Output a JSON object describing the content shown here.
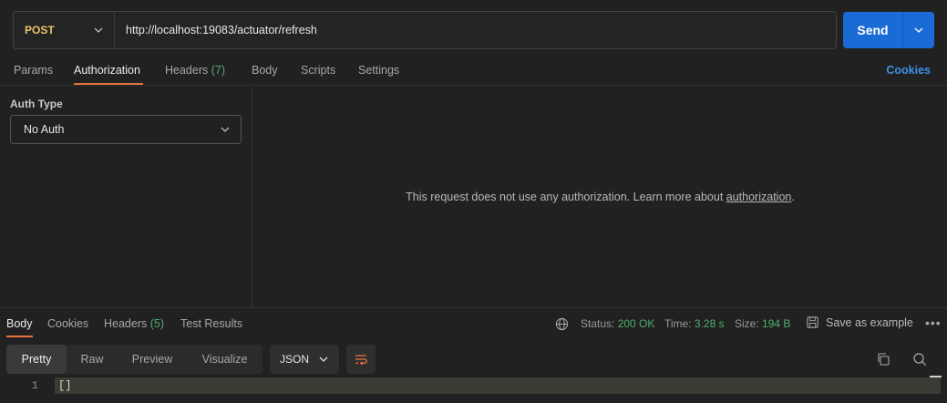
{
  "request": {
    "method": "POST",
    "url": "http://localhost:19083/actuator/refresh",
    "send_label": "Send"
  },
  "request_tabs": {
    "params": "Params",
    "authorization": "Authorization",
    "headers": "Headers",
    "headers_count": "(7)",
    "body": "Body",
    "scripts": "Scripts",
    "settings": "Settings",
    "cookies": "Cookies"
  },
  "auth": {
    "type_label": "Auth Type",
    "selected": "No Auth",
    "message": "This request does not use any authorization. Learn more about ",
    "link": "authorization",
    "message_end": "."
  },
  "response_tabs": {
    "body": "Body",
    "cookies": "Cookies",
    "headers": "Headers",
    "headers_count": "(5)",
    "test_results": "Test Results"
  },
  "response_meta": {
    "status_label": "Status:",
    "status_value": "200 OK",
    "time_label": "Time:",
    "time_value": "3.28 s",
    "size_label": "Size:",
    "size_value": "194 B",
    "save_example": "Save as example",
    "more": "•••"
  },
  "view": {
    "tabs": [
      "Pretty",
      "Raw",
      "Preview",
      "Visualize"
    ],
    "format": "JSON"
  },
  "code": {
    "line_number": "1",
    "content": "[]"
  },
  "colors": {
    "method": "#e9c46a",
    "accent": "#e8733f",
    "send": "#1a6bd6",
    "success": "#4cae70",
    "link": "#3d8fe8"
  },
  "icons": [
    "chevron-down-icon",
    "globe-icon",
    "save-icon",
    "wrap-lines-icon",
    "copy-icon",
    "search-icon",
    "more-icon"
  ]
}
